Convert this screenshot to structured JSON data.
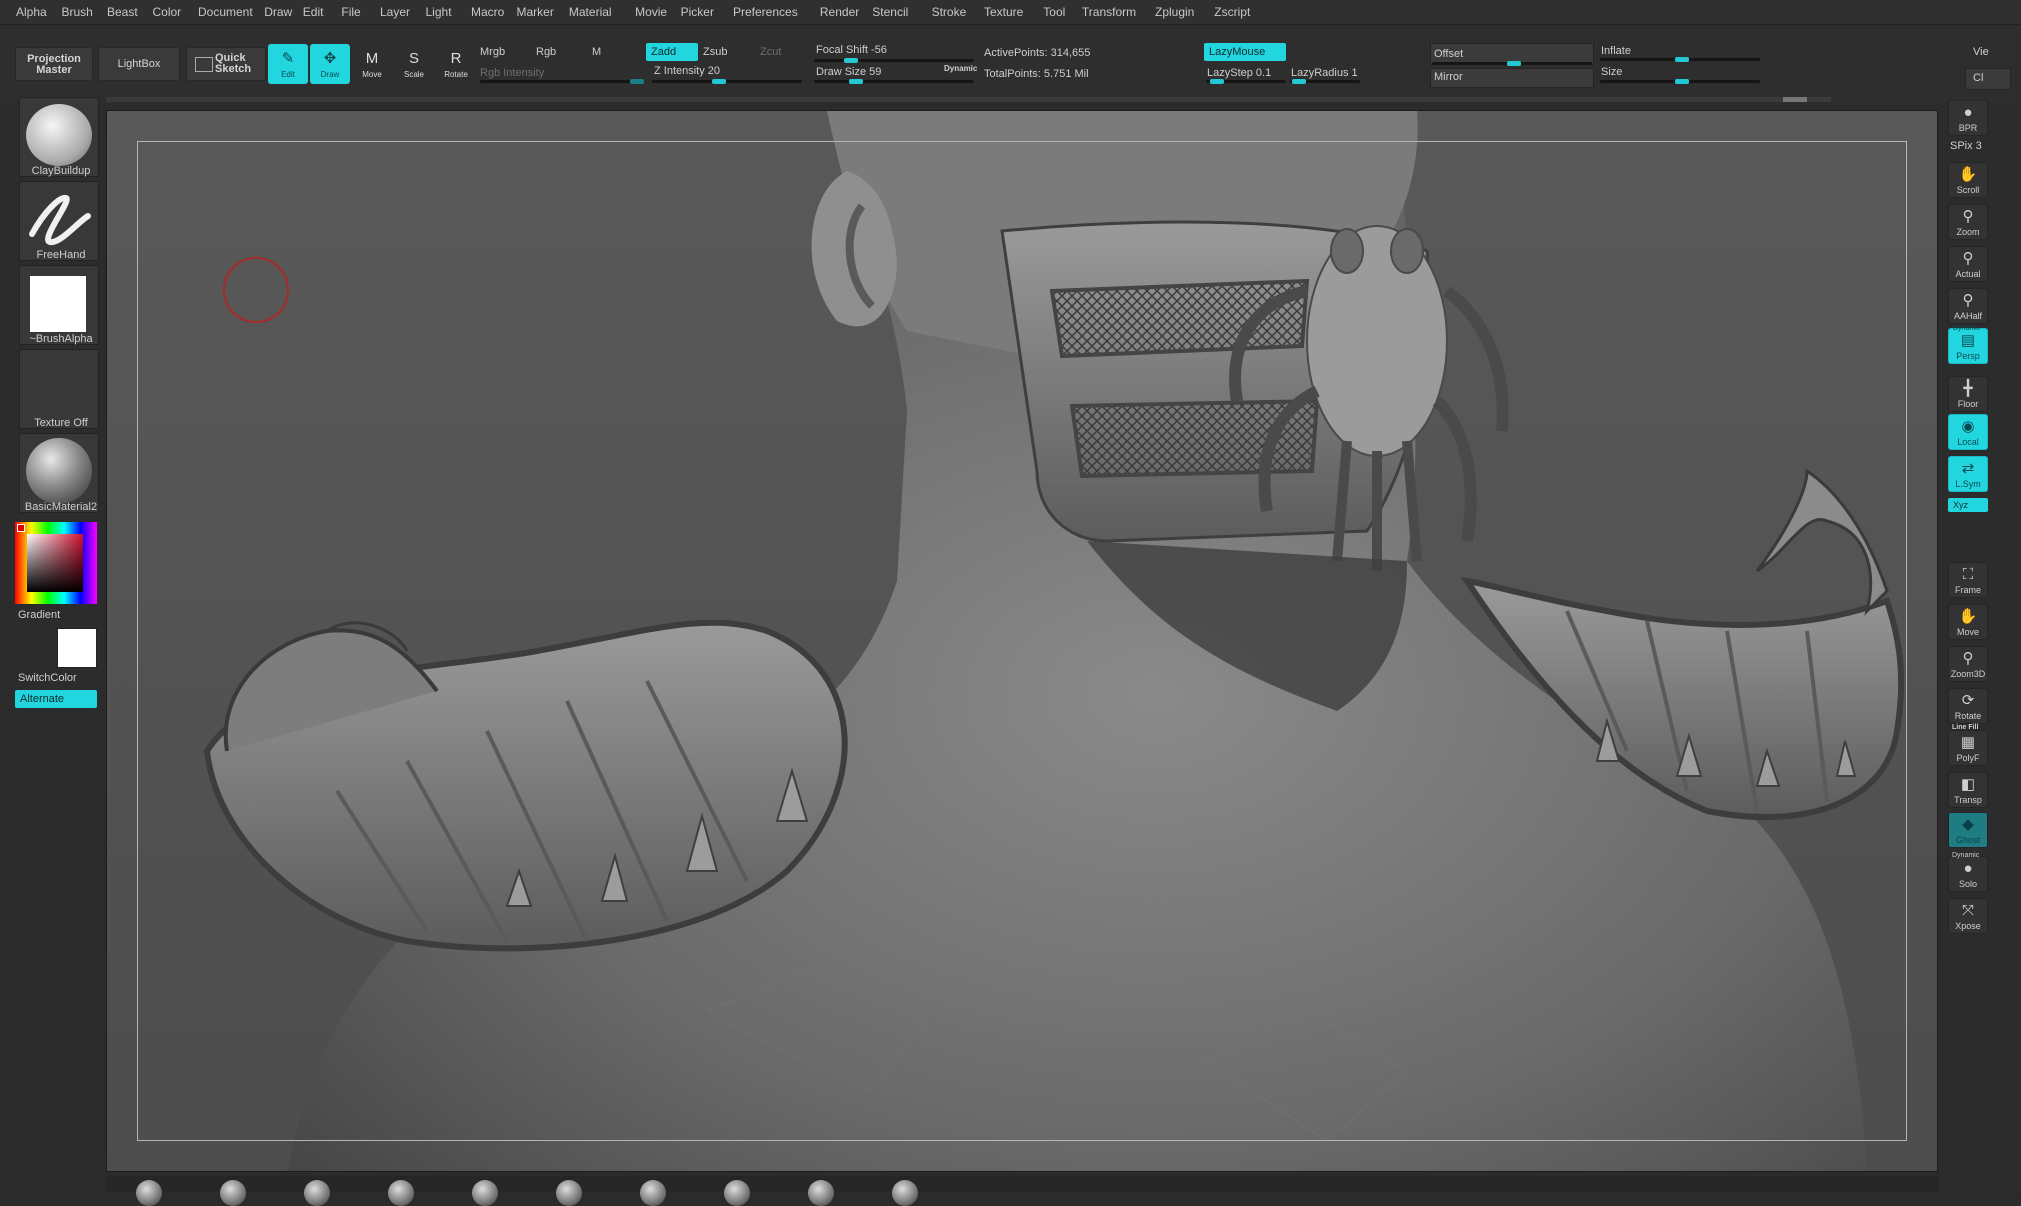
{
  "menu": [
    "Alpha",
    "Brush",
    "Beast",
    "Color",
    "Document",
    "Draw",
    "Edit",
    "File",
    "Layer",
    "Light",
    "Macro",
    "Marker",
    "Material",
    "Movie",
    "Picker",
    "Preferences",
    "Render",
    "Stencil",
    "Stroke",
    "Texture",
    "Tool",
    "Transform",
    "Zplugin",
    "Zscript"
  ],
  "shelf": {
    "projection_master": "Projection Master",
    "lightbox": "LightBox",
    "quick_sketch": "Quick Sketch",
    "tools": [
      {
        "label": "Edit",
        "icon": "edit-icon",
        "active": true
      },
      {
        "label": "Draw",
        "icon": "draw-icon",
        "active": true
      },
      {
        "label": "Move",
        "icon": "move-icon",
        "active": false
      },
      {
        "label": "Scale",
        "icon": "scale-icon",
        "active": false
      },
      {
        "label": "Rotate",
        "icon": "rotate-icon",
        "active": false
      }
    ],
    "mrgb": "Mrgb",
    "rgb": "Rgb",
    "m": "M",
    "zadd": "Zadd",
    "zsub": "Zsub",
    "zcut": "Zcut",
    "rgb_intensity": "Rgb Intensity",
    "z_intensity": "Z Intensity 20",
    "focal_shift": "Focal Shift -56",
    "draw_size": "Draw Size 59",
    "dynamic": "Dynamic",
    "active_points": "ActivePoints: 314,655",
    "total_points": "TotalPoints: 5.751 Mil",
    "lazymouse": "LazyMouse",
    "lazystep": "LazyStep 0.1",
    "lazyradius": "LazyRadius 1",
    "offset": "Offset",
    "mirror": "Mirror",
    "inflate": "Inflate",
    "size": "Size",
    "view": "Vie",
    "clear": "Cl"
  },
  "left": {
    "brush": "ClayBuildup",
    "stroke": "FreeHand",
    "alpha": "~BrushAlpha",
    "texture": "Texture Off",
    "material": "BasicMaterial2",
    "gradient": "Gradient",
    "switchcolor": "SwitchColor",
    "alternate": "Alternate"
  },
  "right": {
    "spix": "SPix 3",
    "buttons": [
      {
        "label": "BPR",
        "icon": "bpr-icon",
        "state": "normal"
      },
      {
        "label": "Scroll",
        "icon": "scroll-icon",
        "state": "normal"
      },
      {
        "label": "Zoom",
        "icon": "zoom-icon",
        "state": "normal"
      },
      {
        "label": "Actual",
        "icon": "actual-icon",
        "state": "normal"
      },
      {
        "label": "AAHalf",
        "icon": "aahalf-icon",
        "state": "normal"
      },
      {
        "label": "Persp",
        "icon": "persp-icon",
        "state": "active"
      },
      {
        "label": "Floor",
        "icon": "floor-icon",
        "state": "normal"
      },
      {
        "label": "Local",
        "icon": "local-icon",
        "state": "active"
      },
      {
        "label": "L.Sym",
        "icon": "lsym-icon",
        "state": "active"
      },
      {
        "label": "Frame",
        "icon": "frame-icon",
        "state": "normal"
      },
      {
        "label": "Move",
        "icon": "move-icon",
        "state": "normal"
      },
      {
        "label": "Zoom3D",
        "icon": "zoom3d-icon",
        "state": "normal"
      },
      {
        "label": "Rotate",
        "icon": "rotate-icon",
        "state": "normal"
      },
      {
        "label": "PolyF",
        "icon": "polyf-icon",
        "state": "normal"
      },
      {
        "label": "Transp",
        "icon": "transp-icon",
        "state": "normal"
      },
      {
        "label": "Ghost",
        "icon": "ghost-icon",
        "state": "teal"
      },
      {
        "label": "Solo",
        "icon": "solo-icon",
        "state": "normal"
      },
      {
        "label": "Xpose",
        "icon": "xpose-icon",
        "state": "normal"
      }
    ],
    "dynamic_top": "Dynamic",
    "xyz": "Xyz",
    "line_fill": "Line Fill",
    "dynamic_bottom": "Dynamic"
  },
  "colors": {
    "accent": "#22d6e0",
    "background": "#2b2b2b",
    "canvas": "#555555"
  }
}
